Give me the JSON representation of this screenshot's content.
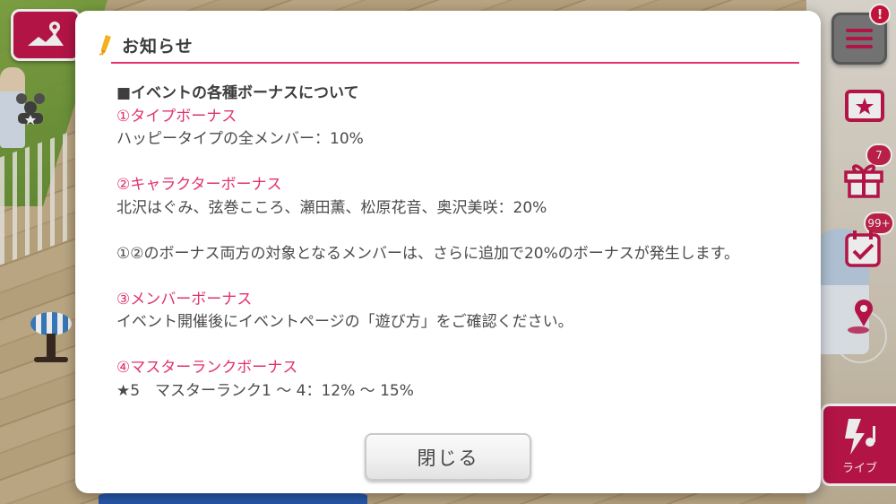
{
  "hud": {
    "menu_alert": "!",
    "gift_count": "7",
    "mission_count": "99+",
    "live_label": "ライブ"
  },
  "notice": {
    "title": "お知らせ",
    "heading": "■イベントの各種ボーナスについて",
    "sections": [
      {
        "title": "①タイプボーナス",
        "text": "ハッピータイプの全メンバー：10%"
      },
      {
        "title": "②キャラクターボーナス",
        "text": "北沢はぐみ、弦巻こころ、瀬田薫、松原花音、奥沢美咲：20%"
      },
      {
        "title": "",
        "text": "①②のボーナス両方の対象となるメンバーは、さらに追加で20%のボーナスが発生します。"
      },
      {
        "title": "③メンバーボーナス",
        "text": "イベント開催後にイベントページの「遊び方」をご確認ください。"
      },
      {
        "title": "④マスターランクボーナス",
        "text": "★5　マスターランク1 〜 4：12% 〜 15%"
      }
    ],
    "close_label": "閉じる"
  },
  "colors": {
    "accent": "#e2336b",
    "hud_pink": "#c2164d",
    "text": "#4a4a4a"
  }
}
